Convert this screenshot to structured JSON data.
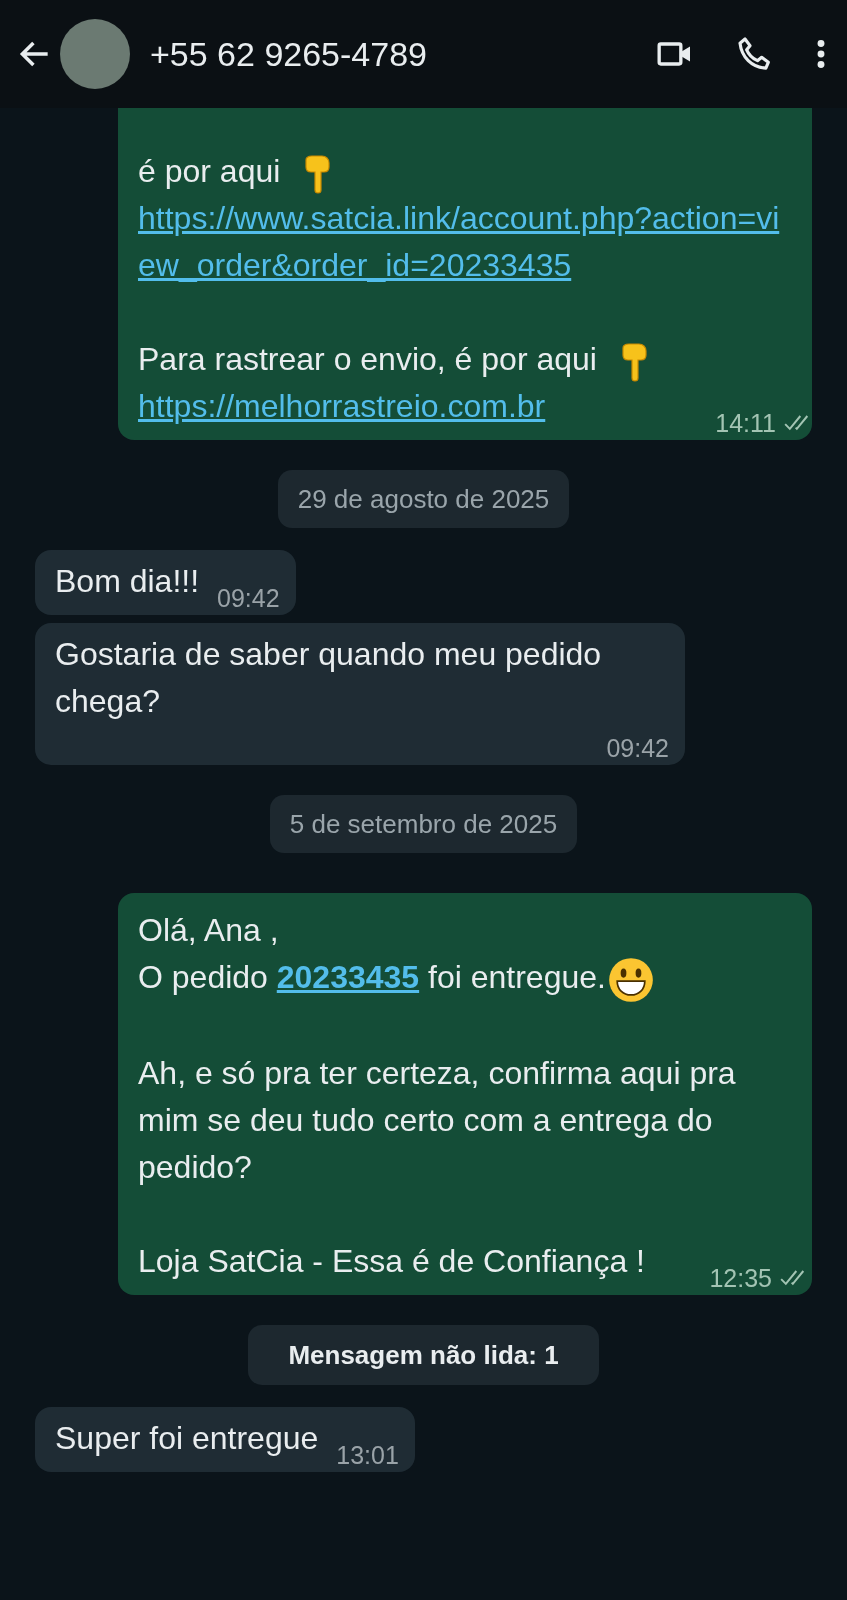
{
  "header": {
    "title": "+55 62 9265-4789"
  },
  "messages": [
    {
      "kind": "outgoing",
      "time": "14:11",
      "read": false,
      "paragraphs": [
        [
          [
            {
              "kind": "text",
              "text": "é por aqui"
            },
            {
              "kind": "pointing-hand"
            }
          ],
          [
            {
              "kind": "link",
              "text": "https://www.satcia.link/account.php?action=view_order&order_id=20233435"
            }
          ]
        ],
        [
          [
            {
              "kind": "text",
              "text": "Para rastrear o envio, é por aqui"
            },
            {
              "kind": "pointing-hand"
            }
          ],
          [
            {
              "kind": "link",
              "text": "https://melhorrastreio.com.br"
            }
          ]
        ]
      ]
    },
    {
      "kind": "date",
      "text": "29 de agosto de 2025"
    },
    {
      "kind": "incoming",
      "time": "09:42",
      "paragraphs": [
        [
          [
            {
              "kind": "text",
              "text": "Bom dia!!!"
            }
          ]
        ]
      ]
    },
    {
      "kind": "incoming",
      "time": "09:42",
      "paragraphs": [
        [
          [
            {
              "kind": "text",
              "text": "Gostaria de saber quando meu pedido chega?"
            }
          ]
        ]
      ]
    },
    {
      "kind": "date",
      "text": "5 de setembro de 2025"
    },
    {
      "kind": "outgoing",
      "time": "12:35",
      "read": false,
      "paragraphs": [
        [
          [
            {
              "kind": "text",
              "text": "Olá, Ana ,"
            }
          ],
          [
            {
              "kind": "text",
              "text": "O pedido "
            },
            {
              "kind": "bold-link",
              "text": "20233435"
            },
            {
              "kind": "text",
              "text": " foi entregue."
            },
            {
              "kind": "grin"
            }
          ]
        ],
        [
          [
            {
              "kind": "text",
              "text": "Ah, e só pra ter certeza, confirma aqui pra mim se deu tudo certo com a entrega do pedido?"
            }
          ]
        ],
        [
          [
            {
              "kind": "text",
              "text": "Loja SatCia - Essa é de Confiança !"
            }
          ]
        ]
      ]
    },
    {
      "kind": "unread",
      "text": "Mensagem não lida: 1"
    },
    {
      "kind": "incoming",
      "time": "13:01",
      "paragraphs": [
        [
          [
            {
              "kind": "text",
              "text": "Super foi entregue"
            }
          ]
        ]
      ]
    }
  ]
}
